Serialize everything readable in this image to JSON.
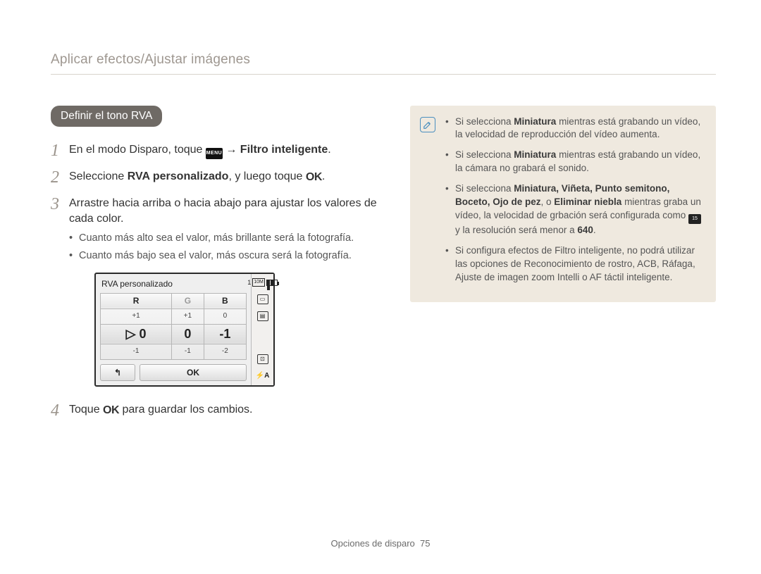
{
  "breadcrumb": "Aplicar efectos/Ajustar imágenes",
  "pill": "Definir el tono RVA",
  "steps": {
    "s1_before": "En el modo Disparo, toque ",
    "s1_menu": "MENU",
    "s1_arrow": " → ",
    "s1_bold": "Filtro inteligente",
    "s1_end": ".",
    "s2_before": "Seleccione ",
    "s2_bold": "RVA personalizado",
    "s2_after": ", y luego toque ",
    "s2_ok": "OK",
    "s2_end": ".",
    "s3": "Arrastre hacia arriba o hacia abajo para ajustar los valores de cada color.",
    "s3_sub1": "Cuanto más alto sea el valor, más brillante será la fotografía.",
    "s3_sub2": "Cuanto más bajo sea el valor, más oscura será la fotografía.",
    "s4_before": "Toque ",
    "s4_ok": "OK",
    "s4_after": " para guardar los cambios."
  },
  "screen": {
    "title": "RVA personalizado",
    "headers": [
      "R",
      "G",
      "B"
    ],
    "row_above": [
      "+1",
      "+1",
      "0"
    ],
    "row_main_arrow": "▷",
    "row_main": [
      "0",
      "0",
      "-1"
    ],
    "row_below": [
      "-1",
      "-1",
      "-2"
    ],
    "btn_back": "↰",
    "btn_ok": "OK",
    "side_count": "1",
    "side_res": "10M",
    "side_flash": "⚡A"
  },
  "note": {
    "b1_a": "Si selecciona ",
    "b1_bold": "Miniatura",
    "b1_b": " mientras está grabando un vídeo, la velocidad de reproducción del vídeo aumenta.",
    "b2_a": "Si selecciona ",
    "b2_bold": "Miniatura",
    "b2_b": " mientras está grabando un vídeo, la cámara no grabará el sonido.",
    "b3_a": "Si selecciona ",
    "b3_list": "Miniatura, Viñeta, Punto semitono, Boceto, Ojo de pez",
    "b3_mid": ", o ",
    "b3_bold2": "Eliminar niebla",
    "b3_b": " mientras graba un vídeo, la velocidad de grbación será configurada como ",
    "b3_resicon": "15",
    "b3_c": " y la resolución será menor a ",
    "b3_bold3": "640",
    "b3_end": ".",
    "b4": "Si configura efectos de Filtro inteligente, no podrá utilizar las opciones de Reconocimiento de rostro, ACB, Ráfaga, Ajuste de imagen zoom Intelli o AF táctil inteligente."
  },
  "footer_section": "Opciones de disparo",
  "footer_page": "75"
}
